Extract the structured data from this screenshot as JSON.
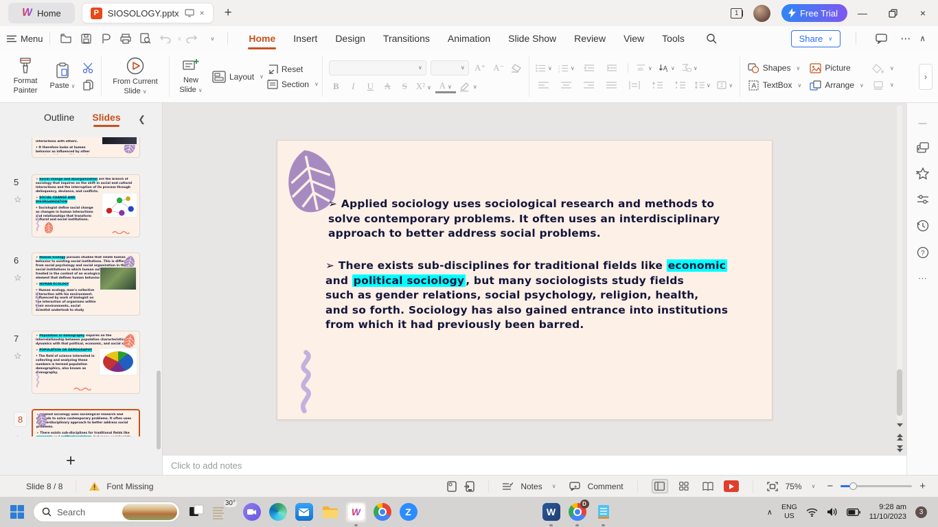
{
  "window": {
    "home_tab": "Home",
    "doc_tab": "SIOSOLOGY.pptx",
    "window_count": "1",
    "free_trial_label": "Free Trial"
  },
  "menubar": {
    "menu_label": "Menu",
    "tabs": [
      "Home",
      "Insert",
      "Design",
      "Transitions",
      "Animation",
      "Slide Show",
      "Review",
      "View",
      "Tools"
    ],
    "active_tab": "Home",
    "share_label": "Share"
  },
  "ribbon": {
    "format_painter": "Format Painter",
    "paste": "Paste",
    "from_current_slide": "From Current Slide",
    "new_slide": "New Slide",
    "layout": "Layout",
    "reset": "Reset",
    "section": "Section",
    "shapes": "Shapes",
    "picture": "Picture",
    "textbox": "TextBox",
    "arrange": "Arrange"
  },
  "sidebar": {
    "outline_tab": "Outline",
    "slides_tab": "Slides",
    "slides": [
      {
        "number": "",
        "partial": true,
        "image": "dark",
        "decor": [
          "leaf-purple-right"
        ],
        "paras": [
          [
            {
              "t": "interactions with others."
            }
          ],
          [
            {
              "t": "• It therefore looks at human behavior as influenced by other people and the conditions under which social behavior and feelings occur."
            }
          ]
        ]
      },
      {
        "number": "5",
        "image": "network",
        "decor": [
          "squiggle-left",
          "leaf-red-bottomleft",
          "wave-bottomright"
        ],
        "paras": [
          [
            {
              "t": "➢ "
            },
            {
              "t": "Social change and disorganization",
              "h": true
            },
            {
              "t": " are the branch of sociology that inquires on the shift in social and cultural interactions and the interruption of its process through delinquency, deviance, and conflicts."
            }
          ],
          [
            {
              "t": "➢ "
            },
            {
              "t": "SOCIAL CHANGE AND DISORGANIZATION",
              "h": true
            }
          ],
          [
            {
              "t": "• Sociologist define social change as changes in human interactions and relationships that transform cultural and social institutions."
            }
          ]
        ]
      },
      {
        "number": "6",
        "image": "plant",
        "decor": [
          "leaf-purple-topright",
          "squiggle-left"
        ],
        "paras": [
          [
            {
              "t": "➢ "
            },
            {
              "t": "Human ecology",
              "h": true
            },
            {
              "t": " pursues studies that relate human behavior to existing social institutions. This is different from social psychology and social organization in that social institutions in which human subjects belong to are treated in the context of an ecological/environmental element that defines human behavior."
            }
          ],
          [
            {
              "t": "➢ "
            },
            {
              "t": "HUMAN ECOLOGY",
              "h": true
            }
          ],
          [
            {
              "t": "• Human ecology, man's collective interaction with his environment. Influenced by work of biologist on the interaction of organisms within their environments, social scientist undertook to study human groups in a similar way"
            }
          ]
        ]
      },
      {
        "number": "7",
        "image": "pie",
        "decor": [
          "leaf-red-topright",
          "squiggle-left",
          "wave-bottomcenter"
        ],
        "paras": [
          [
            {
              "t": "➢ "
            },
            {
              "t": "Population or demography",
              "h": true
            },
            {
              "t": " inquires on the interrelationship between population characteristics and dynamics with that political, economic, and social system."
            }
          ],
          [
            {
              "t": "➢ "
            },
            {
              "t": "POPULATION OR DEMOGRAPHY",
              "h": true
            }
          ],
          [
            {
              "t": "• The field of science interested in collecting and analyzing these numbers is termed population demographics, also known as demography."
            }
          ]
        ]
      },
      {
        "number": "8",
        "selected": true,
        "image": null,
        "decor": [
          "leaf-purple-topleft",
          "squiggle-bottomleft"
        ],
        "paras": [
          [
            {
              "t": "➢ Applied sociology uses sociological research and methods to solve contemporary problems. It often uses an interdisciplinary approach to better address social problems."
            }
          ],
          [
            {
              "t": "➢ There exists sub-disciplines for traditional fields like "
            },
            {
              "t": "economic",
              "h": true
            },
            {
              "t": " and "
            },
            {
              "t": "political sociology",
              "h": true
            },
            {
              "t": ", but many sociologists study fields such as gender relations, social psychology, religion, health, and so forth. Sociology has also gained entrance into institutions from which it had previously been barred."
            }
          ]
        ]
      }
    ]
  },
  "slide": {
    "paragraph1_lines": [
      "➢ Applied sociology uses sociological research and methods to",
      "solve contemporary problems. It often uses an interdisciplinary",
      "approach to better address social problems."
    ],
    "paragraph2_lines": [
      [
        {
          "t": "➢ There exists sub-disciplines for traditional fields like "
        },
        {
          "t": "economic",
          "h": true
        }
      ],
      [
        {
          "t": "and "
        },
        {
          "t": "political sociology",
          "h": true
        },
        {
          "t": ", but many sociologists study fields"
        }
      ],
      [
        {
          "t": "such as gender relations, social psychology, religion, health,"
        }
      ],
      [
        {
          "t": "and so forth. Sociology has also gained entrance into institutions"
        }
      ],
      [
        {
          "t": " from which it had previously been barred."
        }
      ]
    ]
  },
  "notes": {
    "placeholder": "Click to add notes"
  },
  "statusbar": {
    "slide_indicator": "Slide 8 / 8",
    "font_missing": "Font Missing",
    "notes_label": "Notes",
    "comment_label": "Comment",
    "zoom_level": "75%"
  },
  "taskbar": {
    "search_placeholder": "Search",
    "weather_temp": "30°",
    "lang_top": "ENG",
    "lang_bottom": "US",
    "time": "9:28 am",
    "date": "11/10/2023",
    "notification_count": "3"
  },
  "icons": {
    "close": "×",
    "add": "+",
    "ellipsis": "⋯",
    "collapse_up": "∧",
    "dropdown": "∨",
    "chevron_left": "❮",
    "chevron_right": "›",
    "star": "☆"
  },
  "colors": {
    "accent_orange": "#c8511f",
    "highlight_cyan": "#00ffff",
    "share_blue": "#2a6ef5",
    "slide_bg": "#fcf0e7",
    "leaf_purple": "#a78bc0"
  }
}
